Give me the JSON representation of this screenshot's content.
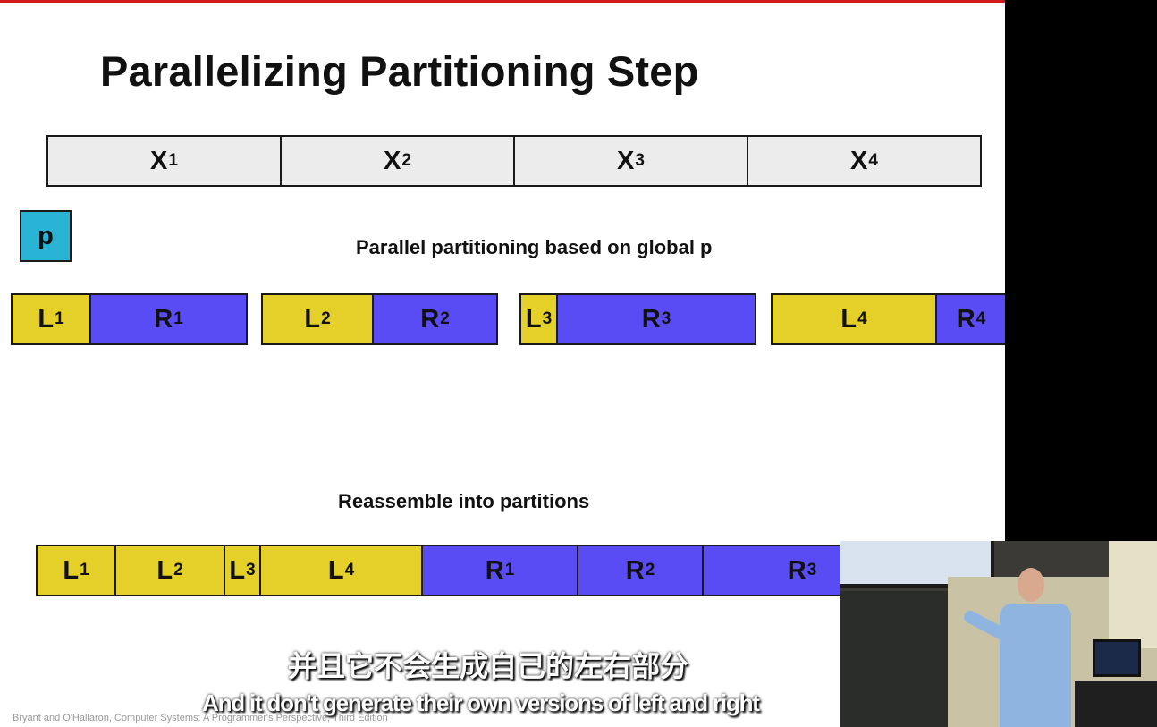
{
  "slide": {
    "title": "Parallelizing Partitioning Step",
    "pivot_label": "p",
    "caption_partition": "Parallel partitioning based on global p",
    "caption_reassemble": "Reassemble into partitions",
    "footer": "Bryant and O'Hallaron, Computer Systems: A Programmer's Perspective, Third Edition"
  },
  "colors": {
    "left": "#e4d028",
    "right": "#5a4cf5",
    "pivot": "#29b4d6",
    "input": "#ececec",
    "accent_bar": "#d21c1c"
  },
  "input_blocks": [
    {
      "base": "X",
      "sub": "1"
    },
    {
      "base": "X",
      "sub": "2"
    },
    {
      "base": "X",
      "sub": "3"
    },
    {
      "base": "X",
      "sub": "4"
    }
  ],
  "partition_blocks": [
    {
      "base": "L",
      "sub": "1"
    },
    {
      "base": "R",
      "sub": "1"
    },
    {
      "base": "L",
      "sub": "2"
    },
    {
      "base": "R",
      "sub": "2"
    },
    {
      "base": "L",
      "sub": "3"
    },
    {
      "base": "R",
      "sub": "3"
    },
    {
      "base": "L",
      "sub": "4"
    },
    {
      "base": "R",
      "sub": "4"
    }
  ],
  "reassembled_blocks": [
    {
      "base": "L",
      "sub": "1"
    },
    {
      "base": "L",
      "sub": "2"
    },
    {
      "base": "L",
      "sub": "3"
    },
    {
      "base": "L",
      "sub": "4"
    },
    {
      "base": "R",
      "sub": "1"
    },
    {
      "base": "R",
      "sub": "2"
    },
    {
      "base": "R",
      "sub": "3"
    }
  ],
  "subtitles": {
    "chinese": "并且它不会生成自己的左右部分",
    "english": "And it don't generate their own versions of left and right"
  },
  "video": {
    "icon": "presenter-video-icon"
  }
}
